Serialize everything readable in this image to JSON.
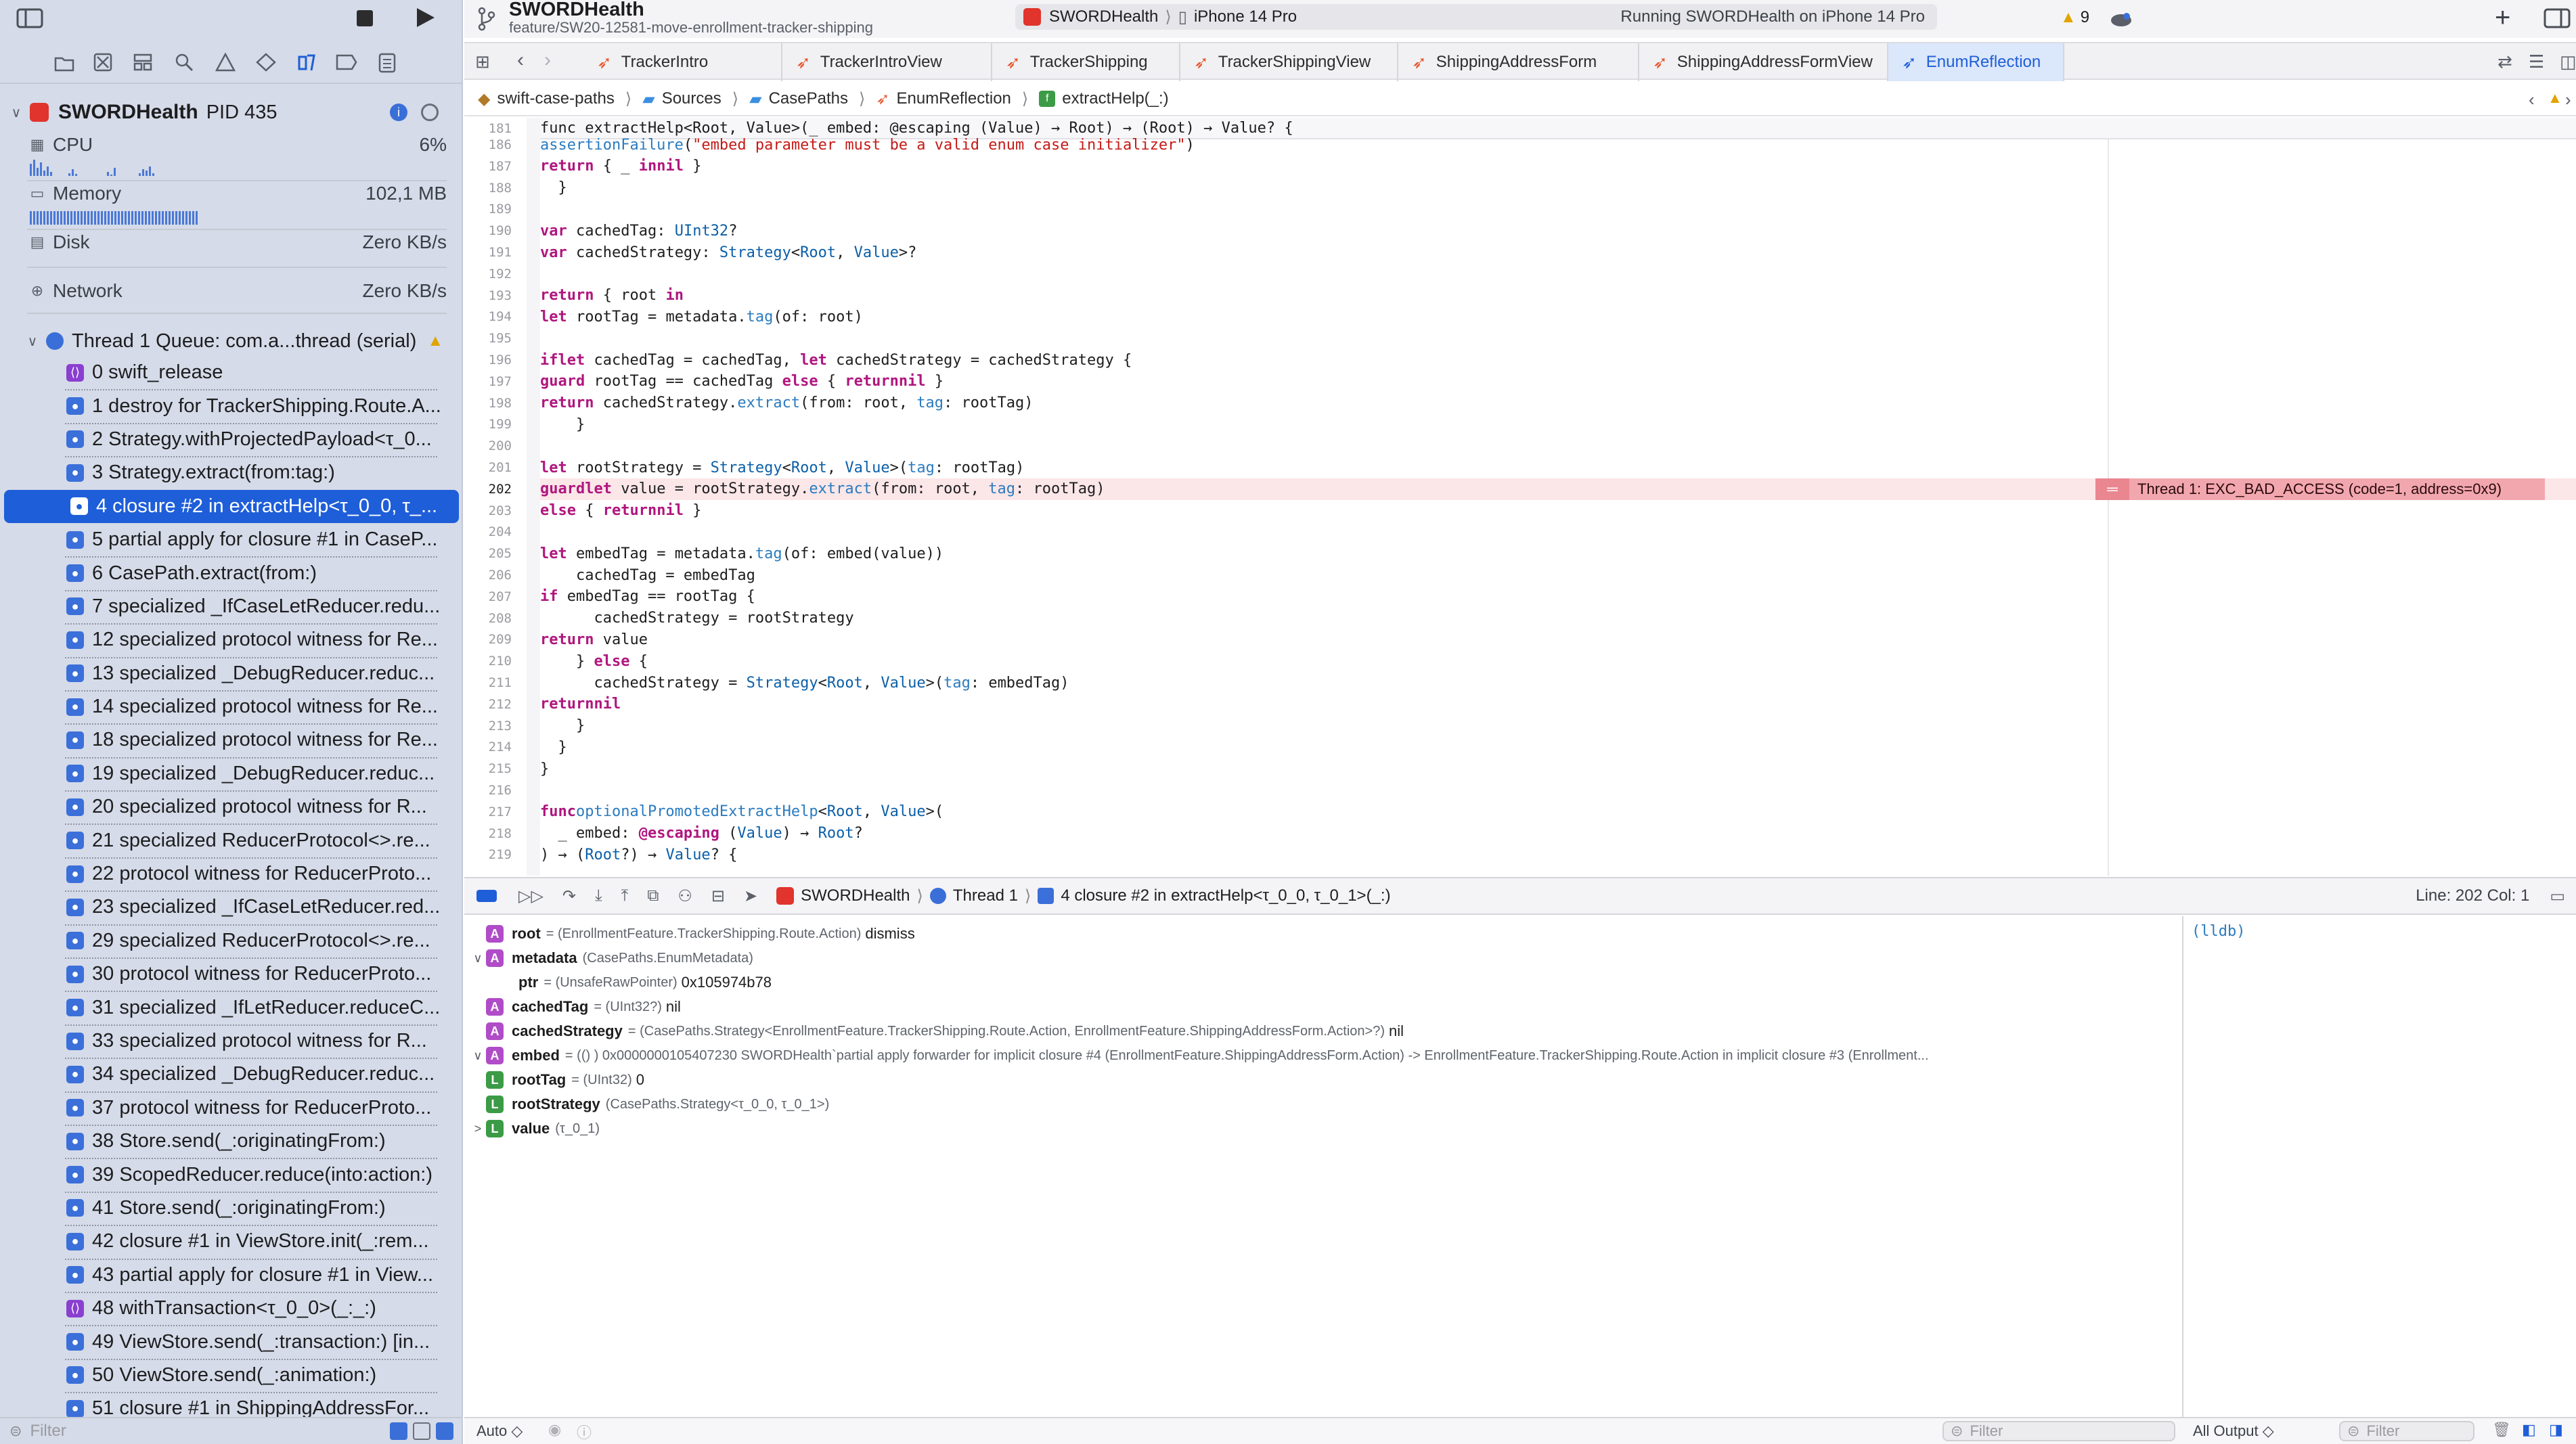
{
  "app": {
    "scheme_title": "SWORDHealth",
    "branch": "feature/SW20-12581-move-enrollment-tracker-shipping",
    "target_app": "SWORDHealth",
    "device": "iPhone 14 Pro",
    "status": "Running SWORDHealth on iPhone 14 Pro",
    "warnings_count": "9"
  },
  "debug_nav": {
    "process_name": "SWORDHealth",
    "process_pid": "PID 435",
    "gauges": [
      {
        "label": "CPU",
        "value": "6%"
      },
      {
        "label": "Memory",
        "value": "102,1 MB"
      },
      {
        "label": "Disk",
        "value": "Zero KB/s"
      },
      {
        "label": "Network",
        "value": "Zero KB/s"
      }
    ],
    "thread_label": "Thread 1 Queue: com.a...thread (serial)",
    "frames": [
      {
        "label": "0 swift_release",
        "icon": "purple"
      },
      {
        "label": "1 destroy for TrackerShipping.Route.A...",
        "icon": "user"
      },
      {
        "label": "2 Strategy.withProjectedPayload<τ_0...",
        "icon": "user"
      },
      {
        "label": "3 Strategy.extract(from:tag:)",
        "icon": "user"
      },
      {
        "label": "4 closure #2 in extractHelp<τ_0_0, τ_...",
        "icon": "user"
      },
      {
        "label": "5 partial apply for closure #1 in CaseP...",
        "icon": "user"
      },
      {
        "label": "6 CasePath.extract(from:)",
        "icon": "user"
      },
      {
        "label": "7 specialized _IfCaseLetReducer.redu...",
        "icon": "user"
      },
      {
        "label": "12 specialized protocol witness for Re...",
        "icon": "user"
      },
      {
        "label": "13 specialized _DebugReducer.reduc...",
        "icon": "user"
      },
      {
        "label": "14 specialized protocol witness for Re...",
        "icon": "user"
      },
      {
        "label": "18 specialized protocol witness for Re...",
        "icon": "user"
      },
      {
        "label": "19 specialized _DebugReducer.reduc...",
        "icon": "user"
      },
      {
        "label": "20 specialized protocol witness for R...",
        "icon": "user"
      },
      {
        "label": "21 specialized ReducerProtocol<>.re...",
        "icon": "user"
      },
      {
        "label": "22 protocol witness for ReducerProto...",
        "icon": "user"
      },
      {
        "label": "23 specialized _IfCaseLetReducer.red...",
        "icon": "user"
      },
      {
        "label": "29 specialized ReducerProtocol<>.re...",
        "icon": "user"
      },
      {
        "label": "30 protocol witness for ReducerProto...",
        "icon": "user"
      },
      {
        "label": "31 specialized _IfLetReducer.reduceC...",
        "icon": "user"
      },
      {
        "label": "33 specialized protocol witness for R...",
        "icon": "user"
      },
      {
        "label": "34 specialized _DebugReducer.reduc...",
        "icon": "user"
      },
      {
        "label": "37 protocol witness for ReducerProto...",
        "icon": "user"
      },
      {
        "label": "38 Store.send(_:originatingFrom:)",
        "icon": "user"
      },
      {
        "label": "39 ScopedReducer.reduce(into:action:)",
        "icon": "user"
      },
      {
        "label": "41 Store.send(_:originatingFrom:)",
        "icon": "user"
      },
      {
        "label": "42 closure #1 in ViewStore.init(_:rem...",
        "icon": "user"
      },
      {
        "label": "43 partial apply for closure #1 in View...",
        "icon": "user"
      },
      {
        "label": "48 withTransaction<τ_0_0>(_:_:)",
        "icon": "purple"
      },
      {
        "label": "49 ViewStore.send(_:transaction:) [in...",
        "icon": "user"
      },
      {
        "label": "50 ViewStore.send(_:animation:)",
        "icon": "user"
      },
      {
        "label": "51 closure #1 in ShippingAddressFor...",
        "icon": "user"
      }
    ],
    "filter_placeholder": "Filter"
  },
  "tabs": [
    {
      "label": "TrackerIntro"
    },
    {
      "label": "TrackerIntroView"
    },
    {
      "label": "TrackerShipping"
    },
    {
      "label": "TrackerShippingView"
    },
    {
      "label": "ShippingAddressForm"
    },
    {
      "label": "ShippingAddressFormView"
    },
    {
      "label": "EnumReflection"
    }
  ],
  "breadcrumb": [
    "swift-case-paths",
    "Sources",
    "CasePaths",
    "EnumReflection",
    "extractHelp(_:)"
  ],
  "editor": {
    "sticky_num": "181",
    "sticky_code": "func extractHelp<Root, Value>(_ embed: @escaping (Value) → Root) → (Root) → Value? {",
    "lines": [
      {
        "n": "186",
        "code": "    assertionFailure(\"embed parameter must be a valid enum case initializer\")"
      },
      {
        "n": "187",
        "code": "    return { _ in nil }"
      },
      {
        "n": "188",
        "code": "  }"
      },
      {
        "n": "189",
        "code": ""
      },
      {
        "n": "190",
        "code": "  var cachedTag: UInt32?"
      },
      {
        "n": "191",
        "code": "  var cachedStrategy: Strategy<Root, Value>?"
      },
      {
        "n": "192",
        "code": ""
      },
      {
        "n": "193",
        "code": "  return { root in"
      },
      {
        "n": "194",
        "code": "    let rootTag = metadata.tag(of: root)"
      },
      {
        "n": "195",
        "code": ""
      },
      {
        "n": "196",
        "code": "    if let cachedTag = cachedTag, let cachedStrategy = cachedStrategy {"
      },
      {
        "n": "197",
        "code": "      guard rootTag == cachedTag else { return nil }"
      },
      {
        "n": "198",
        "code": "      return cachedStrategy.extract(from: root, tag: rootTag)"
      },
      {
        "n": "199",
        "code": "    }"
      },
      {
        "n": "200",
        "code": ""
      },
      {
        "n": "201",
        "code": "    let rootStrategy = Strategy<Root, Value>(tag: rootTag)"
      },
      {
        "n": "202",
        "code": "    guard let value = rootStrategy.extract(from: root, tag: rootTag)"
      },
      {
        "n": "203",
        "code": "    else { return nil }"
      },
      {
        "n": "204",
        "code": ""
      },
      {
        "n": "205",
        "code": "    let embedTag = metadata.tag(of: embed(value))"
      },
      {
        "n": "206",
        "code": "    cachedTag = embedTag"
      },
      {
        "n": "207",
        "code": "    if embedTag == rootTag {"
      },
      {
        "n": "208",
        "code": "      cachedStrategy = rootStrategy"
      },
      {
        "n": "209",
        "code": "      return value"
      },
      {
        "n": "210",
        "code": "    } else {"
      },
      {
        "n": "211",
        "code": "      cachedStrategy = Strategy<Root, Value>(tag: embedTag)"
      },
      {
        "n": "212",
        "code": "      return nil"
      },
      {
        "n": "213",
        "code": "    }"
      },
      {
        "n": "214",
        "code": "  }"
      },
      {
        "n": "215",
        "code": "}"
      },
      {
        "n": "216",
        "code": ""
      },
      {
        "n": "217",
        "code": "func optionalPromotedExtractHelp<Root, Value>("
      },
      {
        "n": "218",
        "code": "  _ embed: @escaping (Value) → Root?"
      },
      {
        "n": "219",
        "code": ") → (Root?) → Value? {"
      }
    ],
    "error_message": "Thread 1: EXC_BAD_ACCESS (code=1, address=0x9)"
  },
  "debug_bar": {
    "crumb_app": "SWORDHealth",
    "crumb_thread": "Thread 1",
    "crumb_frame": "4 closure #2 in extractHelp<τ_0_0, τ_0_1>(_:)",
    "position": "Line: 202  Col: 1"
  },
  "variables": [
    {
      "disc": "",
      "badge": "A",
      "name": "root",
      "type": "= (EnrollmentFeature.TrackerShipping.Route.Action)",
      "value": "dismiss"
    },
    {
      "disc": "∨",
      "badge": "A",
      "name": "metadata",
      "type": "(CasePaths.EnumMetadata)",
      "value": ""
    },
    {
      "disc": "",
      "badge": "",
      "name": "ptr",
      "type": "= (UnsafeRawPointer)",
      "value": "0x105974b78",
      "indent": true
    },
    {
      "disc": "",
      "badge": "A",
      "name": "cachedTag",
      "type": "= (UInt32?)",
      "value": "nil"
    },
    {
      "disc": "",
      "badge": "A",
      "name": "cachedStrategy",
      "type": "= (CasePaths.Strategy<EnrollmentFeature.TrackerShipping.Route.Action, EnrollmentFeature.ShippingAddressForm.Action>?)",
      "value": "nil"
    },
    {
      "disc": "∨",
      "badge": "A",
      "name": "embed",
      "type": "= (() ) 0x0000000105407230 SWORDHealth`partial apply forwarder for implicit closure #4 (EnrollmentFeature.ShippingAddressForm.Action) -> EnrollmentFeature.TrackerShipping.Route.Action in implicit closure #3 (Enrollment...",
      "value": ""
    },
    {
      "disc": "",
      "badge": "L",
      "name": "rootTag",
      "type": "= (UInt32)",
      "value": "0"
    },
    {
      "disc": "",
      "badge": "L",
      "name": "rootStrategy",
      "type": "(CasePaths.Strategy<τ_0_0, τ_0_1>)",
      "value": ""
    },
    {
      "disc": ">",
      "badge": "L",
      "name": "value",
      "type": "(τ_0_1)",
      "value": ""
    }
  ],
  "console": {
    "prompt": "(lldb)",
    "output_select": "All Output ◇",
    "filter_placeholder": "Filter"
  },
  "bottom": {
    "auto_label": "Auto ◇",
    "filter_placeholder": "Filter"
  }
}
